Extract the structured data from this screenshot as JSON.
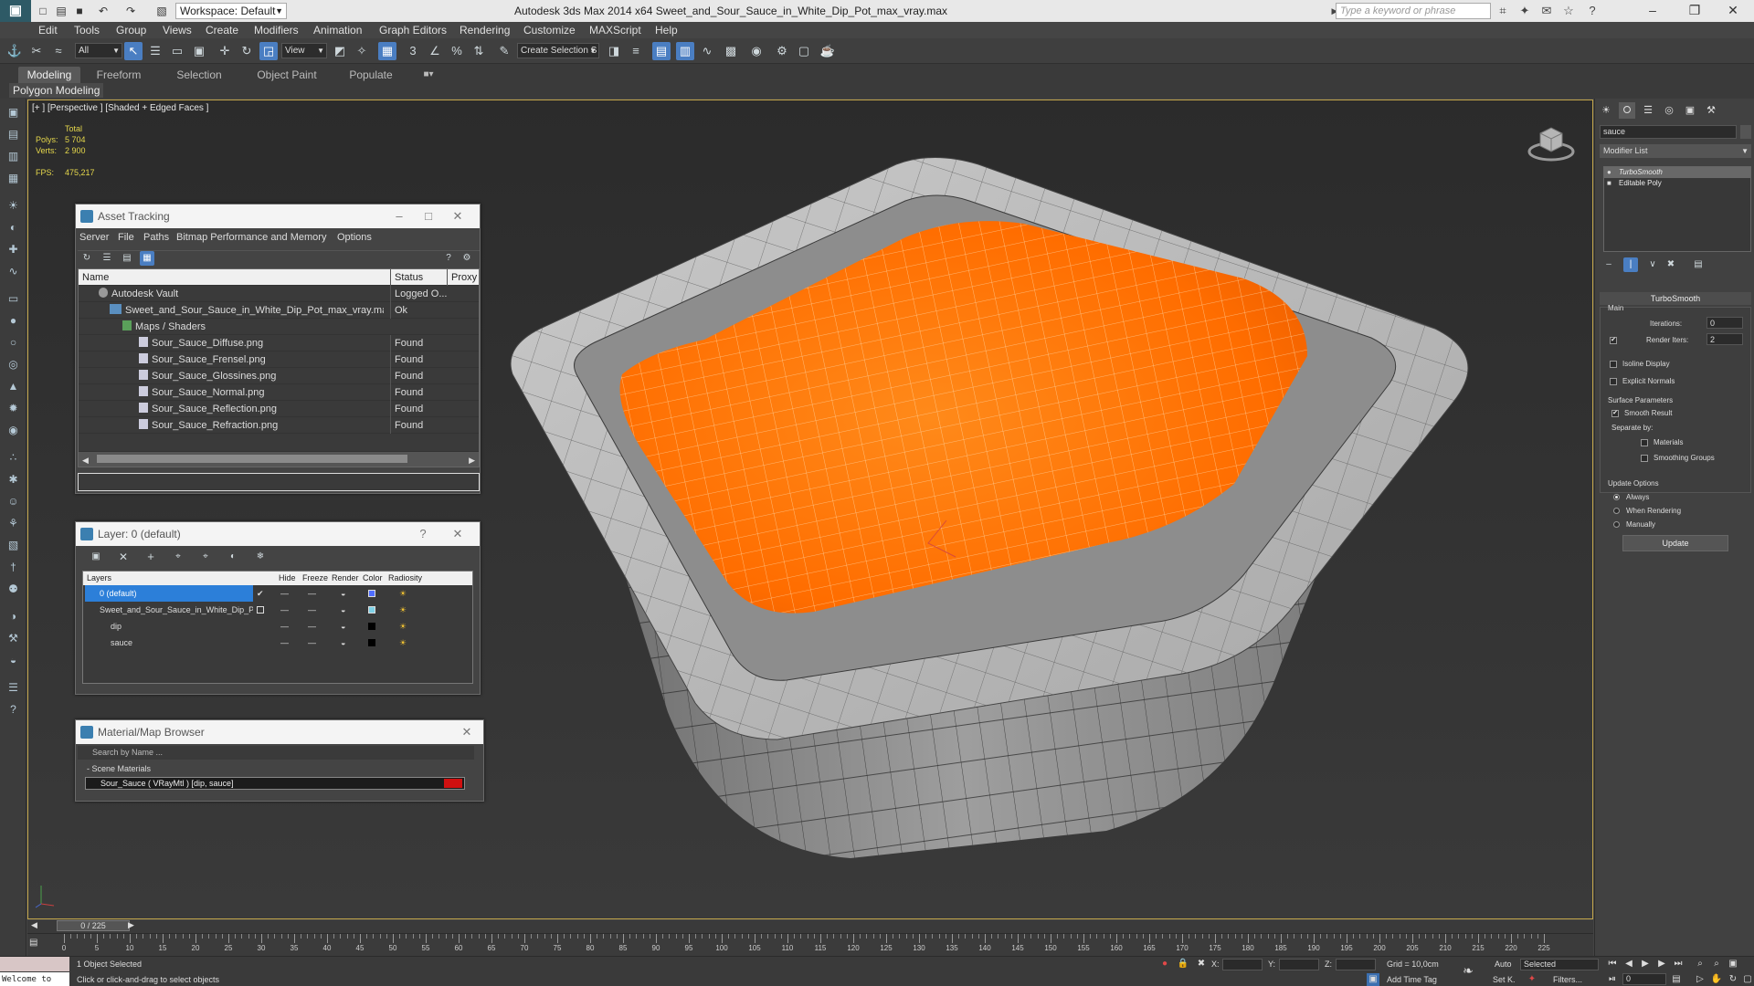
{
  "window": {
    "title": "Autodesk 3ds Max  2014 x64     Sweet_and_Sour_Sauce_in_White_Dip_Pot_max_vray.max",
    "workspace": "Workspace: Default",
    "search_placeholder": "Type a keyword or phrase"
  },
  "menu": [
    "Edit",
    "Tools",
    "Group",
    "Views",
    "Create",
    "Modifiers",
    "Animation",
    "Graph Editors",
    "Rendering",
    "Customize",
    "MAXScript",
    "Help"
  ],
  "toolbar": {
    "selection_filter": "All",
    "ref_coord": "View",
    "named_selection": "Create Selection S"
  },
  "ribbon": {
    "tabs": [
      "Modeling",
      "Freeform",
      "Selection",
      "Object Paint",
      "Populate"
    ],
    "active_tab": "Modeling",
    "sub": "Polygon Modeling"
  },
  "viewport": {
    "label": "[+ ] [Perspective ] [Shaded + Edged Faces ]",
    "stats": {
      "header": "Total",
      "polys_label": "Polys:",
      "polys": "5 704",
      "verts_label": "Verts:",
      "verts": "2 900",
      "fps_label": "FPS:",
      "fps": "475,217"
    }
  },
  "asset_tracking": {
    "title": "Asset Tracking",
    "menu": [
      "Server",
      "File",
      "Paths",
      "Bitmap Performance and Memory",
      "Options"
    ],
    "columns": [
      "Name",
      "Status",
      "Proxy"
    ],
    "rows": [
      {
        "name": "Autodesk Vault",
        "status": "Logged O..."
      },
      {
        "name": "Sweet_and_Sour_Sauce_in_White_Dip_Pot_max_vray.max",
        "status": "Ok"
      },
      {
        "name": "Maps / Shaders",
        "status": ""
      },
      {
        "name": "Sour_Sauce_Diffuse.png",
        "status": "Found"
      },
      {
        "name": "Sour_Sauce_Frensel.png",
        "status": "Found"
      },
      {
        "name": "Sour_Sauce_Glossines.png",
        "status": "Found"
      },
      {
        "name": "Sour_Sauce_Normal.png",
        "status": "Found"
      },
      {
        "name": "Sour_Sauce_Reflection.png",
        "status": "Found"
      },
      {
        "name": "Sour_Sauce_Refraction.png",
        "status": "Found"
      }
    ]
  },
  "layer_panel": {
    "title": "Layer: 0 (default)",
    "help": "?",
    "columns": [
      "Layers",
      "Hide",
      "Freeze",
      "Render",
      "Color",
      "Radiosity"
    ],
    "rows": [
      {
        "name": "0 (default)",
        "color": "#4f6dff"
      },
      {
        "name": "Sweet_and_Sour_Sauce_in_White_Dip_Pot",
        "color": "#7fd1e6"
      },
      {
        "name": "dip",
        "color": "#000000"
      },
      {
        "name": "sauce",
        "color": "#000000"
      }
    ]
  },
  "material_browser": {
    "title": "Material/Map Browser",
    "search_placeholder": "Search by Name ...",
    "section": "- Scene Materials",
    "item": "Sour_Sauce  ( VRayMtl )  [dip, sauce]",
    "swatch_color": "#d01010"
  },
  "command_panel": {
    "object_name": "sauce",
    "modifier_list": "Modifier List",
    "stack": [
      "TurboSmooth",
      "Editable Poly"
    ],
    "turbosmooth": {
      "header": "TurboSmooth",
      "main": "Main",
      "iterations_label": "Iterations:",
      "iterations": "0",
      "render_iters_label": "Render Iters:",
      "render_iters": "2",
      "isoline": "Isoline Display",
      "explicit_normals": "Explicit Normals",
      "surface_params": "Surface Parameters",
      "smooth_result": "Smooth Result",
      "separate_by": "Separate by:",
      "materials": "Materials",
      "smoothing_groups": "Smoothing Groups",
      "update_options": "Update Options",
      "always": "Always",
      "when_rendering": "When Rendering",
      "manually": "Manually",
      "update_button": "Update"
    }
  },
  "timeline": {
    "slider": "0 / 225",
    "ticks": [
      "0",
      "5",
      "10",
      "15",
      "20",
      "25",
      "30",
      "35",
      "40",
      "45",
      "50",
      "55",
      "60",
      "65",
      "70",
      "75",
      "80",
      "85",
      "90",
      "95",
      "100",
      "105",
      "110",
      "115",
      "120",
      "125",
      "130",
      "135",
      "140",
      "145",
      "150",
      "155",
      "160",
      "165",
      "170",
      "175",
      "180",
      "185",
      "190",
      "195",
      "200",
      "205",
      "210",
      "215",
      "220",
      "225"
    ]
  },
  "status": {
    "maxscript": "Welcome to",
    "selected": "1 Object Selected",
    "prompt": "Click or click-and-drag to select objects",
    "x_label": "X:",
    "y_label": "Y:",
    "z_label": "Z:",
    "grid": "Grid = 10,0cm",
    "add_time_tag": "Add Time Tag",
    "auto": "Auto",
    "set_key": "Set K.",
    "selected_dd": "Selected",
    "filters": "Filters...",
    "frame": "0"
  },
  "colors": {
    "accent": "#4a7ec2",
    "sauce": "#ff7a00",
    "viewport_bg": "#2f2f2f",
    "viewport_border": "#c2a54a"
  }
}
